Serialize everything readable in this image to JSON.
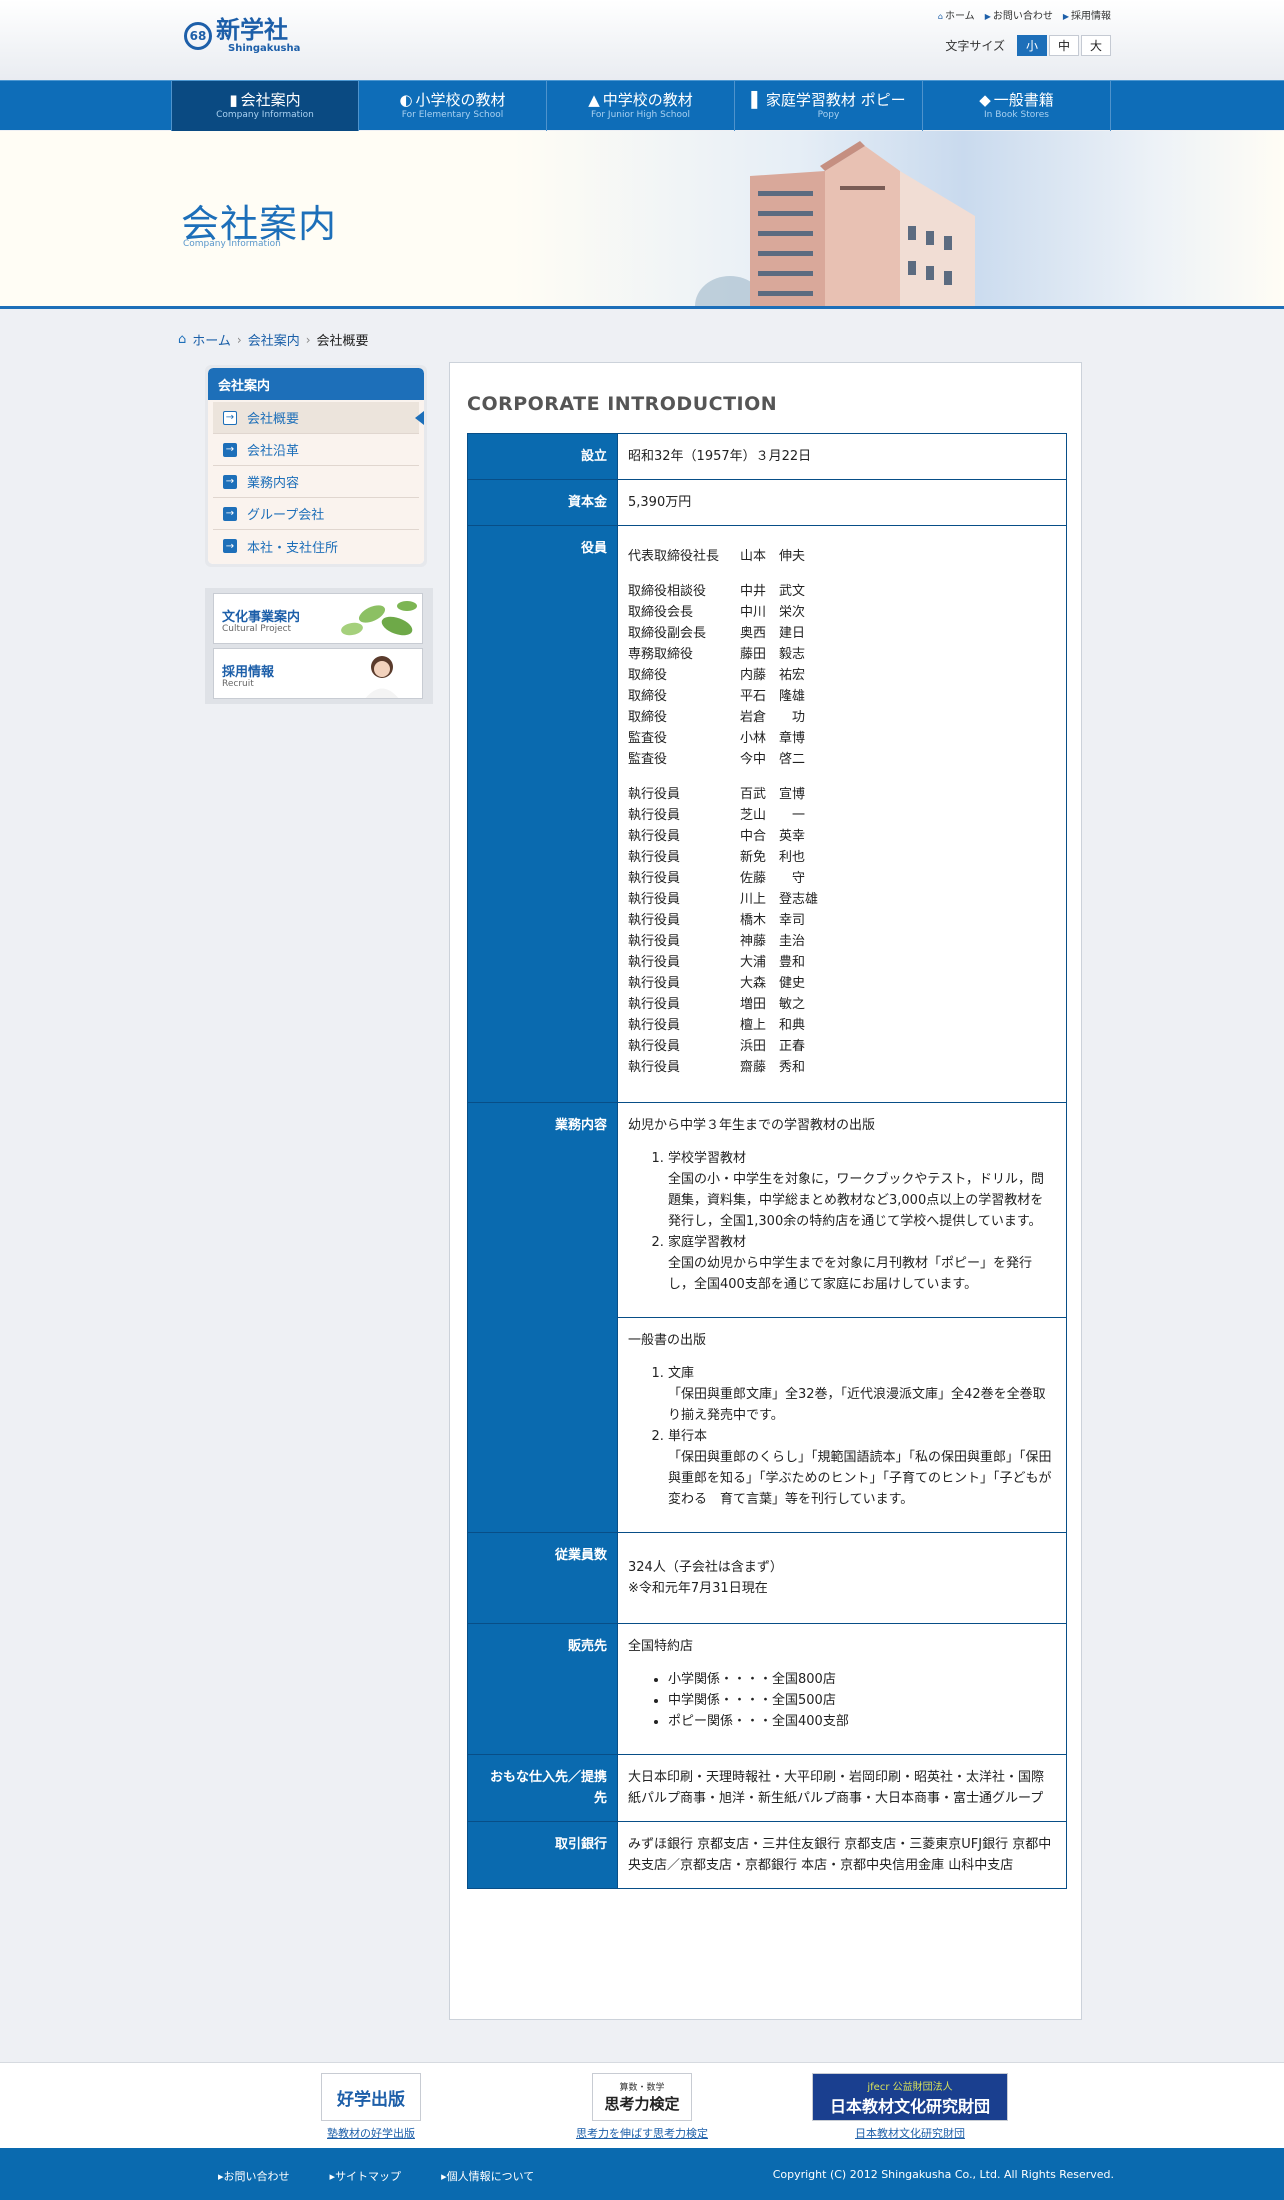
{
  "header": {
    "logo_mark": "68",
    "logo_jp": "新学社",
    "logo_en": "Shingakusha",
    "util_links": [
      "ホーム",
      "お問い合わせ",
      "採用情報"
    ],
    "font_size_label": "文字サイズ",
    "font_sizes": [
      "小",
      "中",
      "大"
    ],
    "active_font_size": "小"
  },
  "nav": [
    {
      "jp": "会社案内",
      "en": "Company Information"
    },
    {
      "jp": "小学校の教材",
      "en": "For Elementary School"
    },
    {
      "jp": "中学校の教材",
      "en": "For Junior High School"
    },
    {
      "jp": "家庭学習教材 ポピー",
      "en": "Popy"
    },
    {
      "jp": "一般書籍",
      "en": "In Book Stores"
    }
  ],
  "hero": {
    "title": "会社案内",
    "subtitle": "Company Information"
  },
  "breadcrumb": {
    "home": "ホーム",
    "section": "会社案内",
    "current": "会社概要"
  },
  "sidebar": {
    "heading": "会社案内",
    "items": [
      "会社概要",
      "会社沿革",
      "業務内容",
      "グループ会社",
      "本社・支社住所"
    ],
    "banners": [
      {
        "jp": "文化事業案内",
        "en": "Cultural Project"
      },
      {
        "jp": "採用情報",
        "en": "Recruit"
      }
    ]
  },
  "main": {
    "heading": "CORPORATE INTRODUCTION",
    "rows": {
      "founded": {
        "label": "設立",
        "value": "昭和32年（1957年）３月22日"
      },
      "capital": {
        "label": "資本金",
        "value": "5,390万円"
      },
      "officers_label": "役員",
      "officers": [
        [
          [
            "代表取締役社長",
            "山本　伸夫"
          ]
        ],
        [
          [
            "取締役相談役",
            "中井　武文"
          ],
          [
            "取締役会長",
            "中川　栄次"
          ],
          [
            "取締役副会長",
            "奥西　建日"
          ],
          [
            "専務取締役",
            "藤田　毅志"
          ],
          [
            "取締役",
            "内藤　祐宏"
          ],
          [
            "取締役",
            "平石　隆雄"
          ],
          [
            "取締役",
            "岩倉　　功"
          ],
          [
            "監査役",
            "小林　章博"
          ],
          [
            "監査役",
            "今中　啓二"
          ]
        ],
        [
          [
            "執行役員",
            "百武　宣博"
          ],
          [
            "執行役員",
            "芝山　　一"
          ],
          [
            "執行役員",
            "中合　英幸"
          ],
          [
            "執行役員",
            "新免　利也"
          ],
          [
            "執行役員",
            "佐藤　　守"
          ],
          [
            "執行役員",
            "川上　登志雄"
          ],
          [
            "執行役員",
            "橋木　幸司"
          ],
          [
            "執行役員",
            "神藤　圭治"
          ],
          [
            "執行役員",
            "大浦　豊和"
          ],
          [
            "執行役員",
            "大森　健史"
          ],
          [
            "執行役員",
            "増田　敏之"
          ],
          [
            "執行役員",
            "檀上　和典"
          ],
          [
            "執行役員",
            "浜田　正春"
          ],
          [
            "執行役員",
            "齋藤　秀和"
          ]
        ]
      ],
      "business": {
        "label": "業務内容",
        "block1_intro": "幼児から中学３年生までの学習教材の出版",
        "block1_items": [
          {
            "title": "学校学習教材",
            "text": "全国の小・中学生を対象に，ワークブックやテスト，ドリル，問題集，資料集，中学総まとめ教材など3,000点以上の学習教材を発行し，全国1,300余の特約店を通じて学校へ提供しています。"
          },
          {
            "title": "家庭学習教材",
            "text": "全国の幼児から中学生までを対象に月刊教材「ポピー」を発行し，全国400支部を通じて家庭にお届けしています。"
          }
        ],
        "block2_intro": "一般書の出版",
        "block2_items": [
          {
            "title": "文庫",
            "text": "「保田與重郎文庫」全32巻，「近代浪漫派文庫」全42巻を全巻取り揃え発売中です。"
          },
          {
            "title": "単行本",
            "text": "「保田與重郎のくらし」「規範国語読本」「私の保田與重郎」「保田與重郎を知る」「学ぶためのヒント」「子育てのヒント」「子どもが変わる　育て言葉」等を刊行しています。"
          }
        ]
      },
      "employees": {
        "label": "従業員数",
        "line1": "324人（子会社は含まず）",
        "line2": "※令和元年7月31日現在"
      },
      "sales": {
        "label": "販売先",
        "intro": "全国特約店",
        "items": [
          "小学関係・・・・全国800店",
          "中学関係・・・・全国500店",
          "ポピー関係・・・全国400支部"
        ]
      },
      "suppliers": {
        "label": "おもな仕入先／提携先",
        "value": "大日本印刷・天理時報社・大平印刷・岩岡印刷・昭英社・太洋社・国際紙パルプ商事・旭洋・新生紙パルプ商事・大日本商事・富士通グループ"
      },
      "banks": {
        "label": "取引銀行",
        "value": "みずほ銀行 京都支店・三井住友銀行 京都支店・三菱東京UFJ銀行 京都中央支店／京都支店・京都銀行 本店・京都中央信用金庫 山科中支店"
      }
    }
  },
  "footer": {
    "banners": [
      {
        "logo": "好学出版",
        "caption": "塾教材の好学出版"
      },
      {
        "logo_top": "算数・数学",
        "logo": "思考力検定",
        "caption": "思考力を伸ばす思考力検定"
      },
      {
        "logo_top": "jfecr 公益財団法人",
        "logo": "日本教材文化研究財団",
        "caption": "日本教材文化研究財団"
      }
    ],
    "links": [
      "お問い合わせ",
      "サイトマップ",
      "個人情報について"
    ],
    "copyright": "Copyright (C) 2012  Shingakusha Co., Ltd. All Rights Reserved."
  }
}
